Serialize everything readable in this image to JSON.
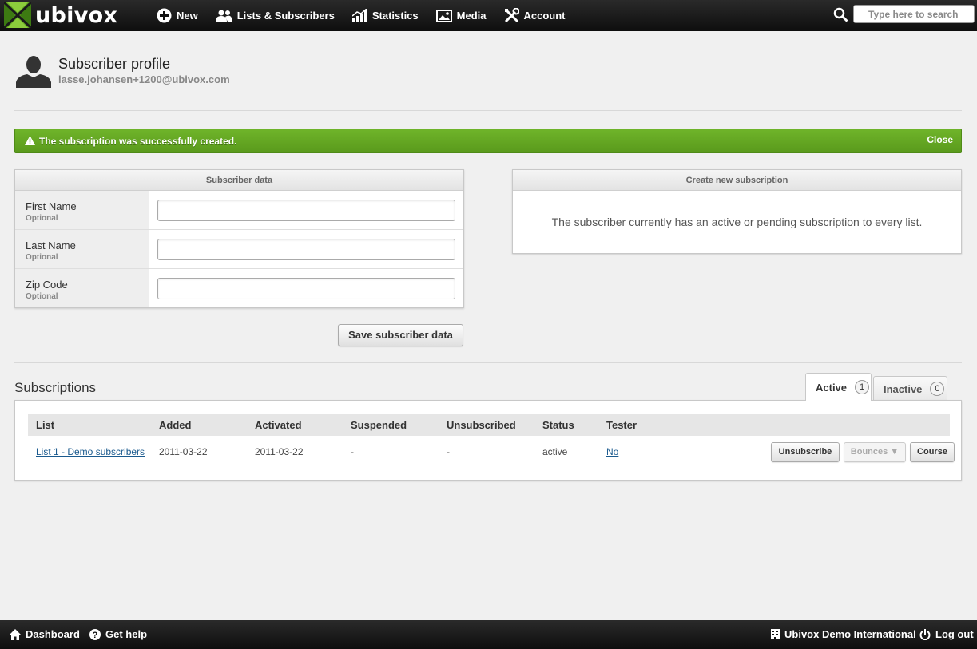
{
  "brand": {
    "name": "ubivox",
    "green": "#5fa221"
  },
  "nav": [
    {
      "label": "New",
      "icon": "plus-circle-icon"
    },
    {
      "label": "Lists & Subscribers",
      "icon": "users-icon"
    },
    {
      "label": "Statistics",
      "icon": "bar-chart-icon"
    },
    {
      "label": "Media",
      "icon": "image-icon"
    },
    {
      "label": "Account",
      "icon": "tools-icon"
    }
  ],
  "search": {
    "placeholder": "Type here to search"
  },
  "profile": {
    "title": "Subscriber profile",
    "email": "lasse.johansen+1200@ubivox.com"
  },
  "alert": {
    "message": "The subscription was successfully created.",
    "close_label": "Close",
    "color": "#66ac24"
  },
  "subscriber_data": {
    "header": "Subscriber data",
    "fields": [
      {
        "label": "First Name",
        "hint": "Optional",
        "value": ""
      },
      {
        "label": "Last Name",
        "hint": "Optional",
        "value": ""
      },
      {
        "label": "Zip Code",
        "hint": "Optional",
        "value": ""
      }
    ],
    "save_label": "Save subscriber data"
  },
  "create_subscription": {
    "header": "Create new subscription",
    "message": "The subscriber currently has an active or pending subscription to every list."
  },
  "subscriptions": {
    "title": "Subscriptions",
    "tabs": [
      {
        "label": "Active",
        "count": "1"
      },
      {
        "label": "Inactive",
        "count": "0"
      }
    ],
    "columns": [
      "List",
      "Added",
      "Activated",
      "Suspended",
      "Unsubscribed",
      "Status",
      "Tester"
    ],
    "rows": [
      {
        "list": "List 1 - Demo subscribers",
        "added": "2011-03-22",
        "activated": "2011-03-22",
        "suspended": "-",
        "unsubscribed": "-",
        "status": "active",
        "tester": "No",
        "actions": {
          "unsubscribe": "Unsubscribe",
          "bounces": "Bounces ▼",
          "course": "Course"
        }
      }
    ]
  },
  "footer": {
    "dashboard": "Dashboard",
    "help": "Get help",
    "company": "Ubivox Demo International",
    "logout": "Log out"
  }
}
